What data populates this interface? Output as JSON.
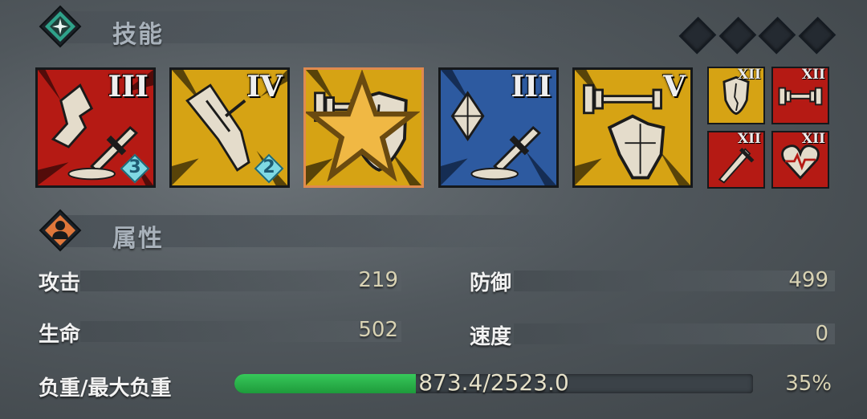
{
  "skills_section": {
    "title": "技能",
    "skills": [
      {
        "icon": "broken-arm-sword-icon",
        "tier": "III",
        "gem": "3",
        "color": "#c8201a"
      },
      {
        "icon": "broken-sword-icon",
        "tier": "IV",
        "gem": "2",
        "color": "#d6a314"
      },
      {
        "icon": "dumbbell-shield-icon",
        "tier": "",
        "star": true,
        "color": "#d6a314",
        "selected": true
      },
      {
        "icon": "crystal-sword-icon",
        "tier": "III",
        "color": "#2d5aa0"
      },
      {
        "icon": "dumbbell-armor-icon",
        "tier": "V",
        "color": "#d6a314"
      }
    ],
    "small_skills": [
      {
        "icon": "shield-icon",
        "tier": "XII",
        "color": "#d6a314"
      },
      {
        "icon": "dumbbell-icon",
        "tier": "XII",
        "color": "#c8201a"
      },
      {
        "icon": "sword-icon",
        "tier": "XII",
        "color": "#c8201a"
      },
      {
        "icon": "heart-icon",
        "tier": "XII",
        "color": "#c8201a"
      }
    ]
  },
  "attributes_section": {
    "title": "属性",
    "stats": {
      "attack_label": "攻击",
      "attack_value": "219",
      "defense_label": "防御",
      "defense_value": "499",
      "life_label": "生命",
      "life_value": "502",
      "speed_label": "速度",
      "speed_value": "0"
    },
    "weight": {
      "label": "负重/最大负重",
      "text": "873.4/2523.0",
      "percent_text": "35%",
      "fraction": 0.35
    }
  },
  "colors": {
    "skills_emblem": "#2fa28a",
    "attributes_emblem": "#e0773a",
    "weight_fill": "#2ab64d"
  }
}
